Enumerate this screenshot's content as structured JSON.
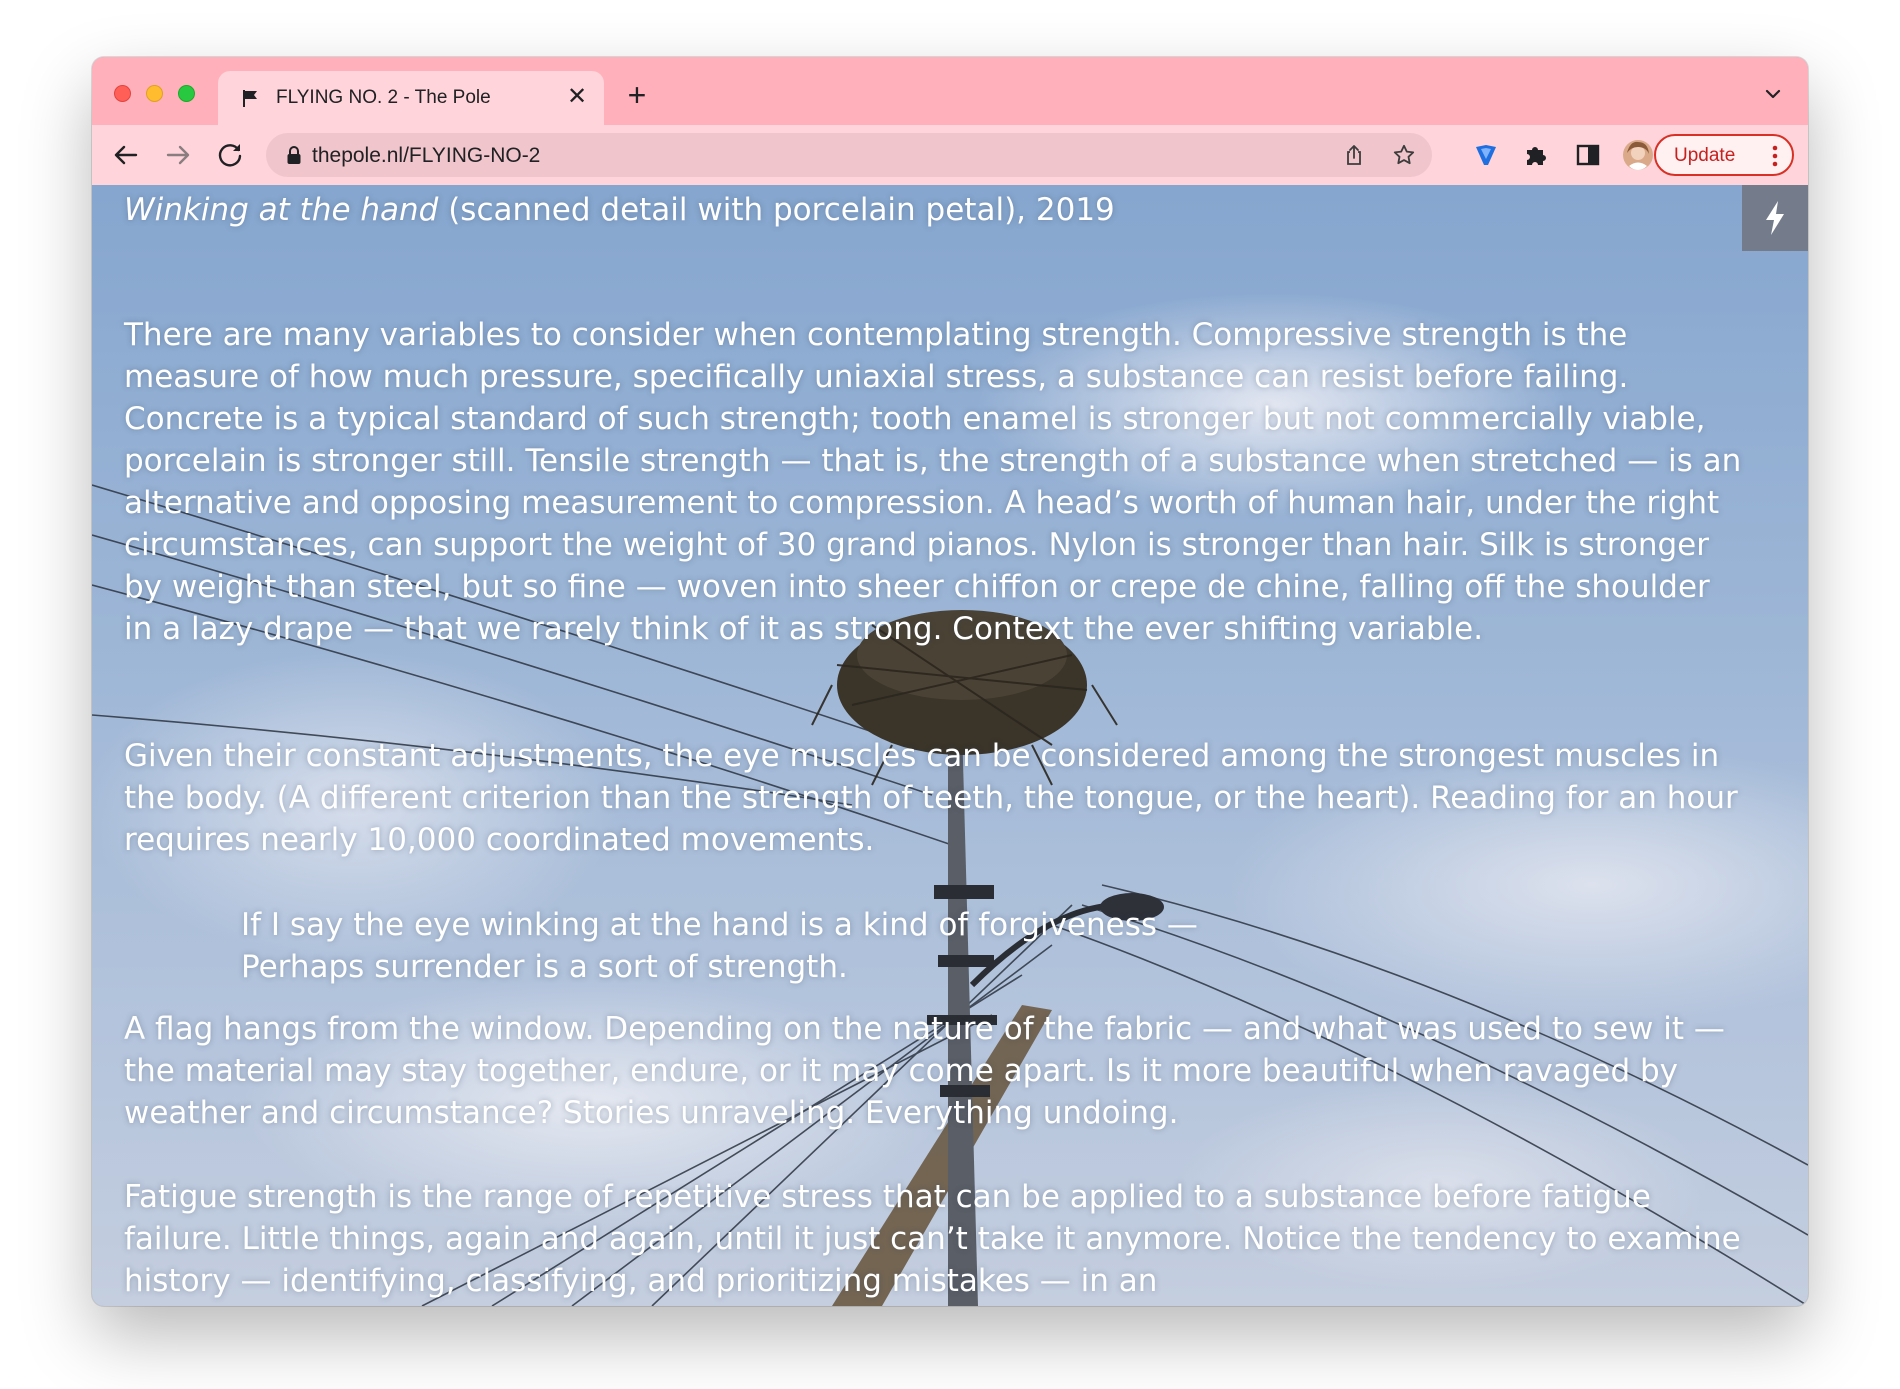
{
  "browser": {
    "tab": {
      "title": "FLYING NO. 2 - The Pole",
      "close_glyph": "✕",
      "favicon": "flag-icon"
    },
    "new_tab_glyph": "+",
    "address": {
      "url": "thepole.nl/FLYING-NO-2"
    },
    "update_button": {
      "label": "Update"
    },
    "colors": {
      "tabstrip": "#ffb0ba",
      "toolbar": "#ffd4da",
      "update_border": "#d93025"
    }
  },
  "page": {
    "caption_title": "Winking at the hand",
    "caption_rest": " (scanned detail with porcelain petal), 2019",
    "paragraphs": [
      "There are many variables to consider when contemplating strength. Compressive strength is the measure of how much pressure, specifically uniaxial stress, a substance can resist before failing. Concrete is a typical standard of such strength; tooth enamel is stronger but not commercially viable, porcelain is stronger still. Tensile strength — that is, the strength of a substance when stretched — is an alternative and opposing measurement to compression. A head’s worth of human hair, under the right circumstances, can support the weight of 30 grand pianos. Nylon is stronger than hair. Silk is stronger by weight than steel, but so fine — woven into sheer chiffon or crepe de chine, falling off the shoulder in a lazy drape — that we rarely think of it as strong. Context the ever shifting variable.",
      "Given their constant adjustments, the eye muscles can be considered among the strongest muscles in the body. (A different criterion than the strength of teeth, the tongue, or the heart). Reading for an hour requires nearly 10,000 coordinated movements."
    ],
    "quote_lines": [
      "If I say the eye winking at the hand is a kind of forgiveness —",
      "Perhaps surrender is a sort of strength."
    ],
    "paragraphs_after": [
      "A flag hangs from the window. Depending on the nature of the fabric — and what was used to sew it — the material may stay together, endure, or it may come apart. Is it more beautiful when ravaged by weather and circumstance? Stories unraveling. Everything undoing.",
      "Fatigue strength is the range of repetitive stress that can be applied to a substance before fatigue failure. Little things, again and again, until it just can’t take it anymore. Notice the tendency to examine history — identifying, classifying, and prioritizing mistakes — in an"
    ],
    "flash_icon": "lightning-icon"
  }
}
